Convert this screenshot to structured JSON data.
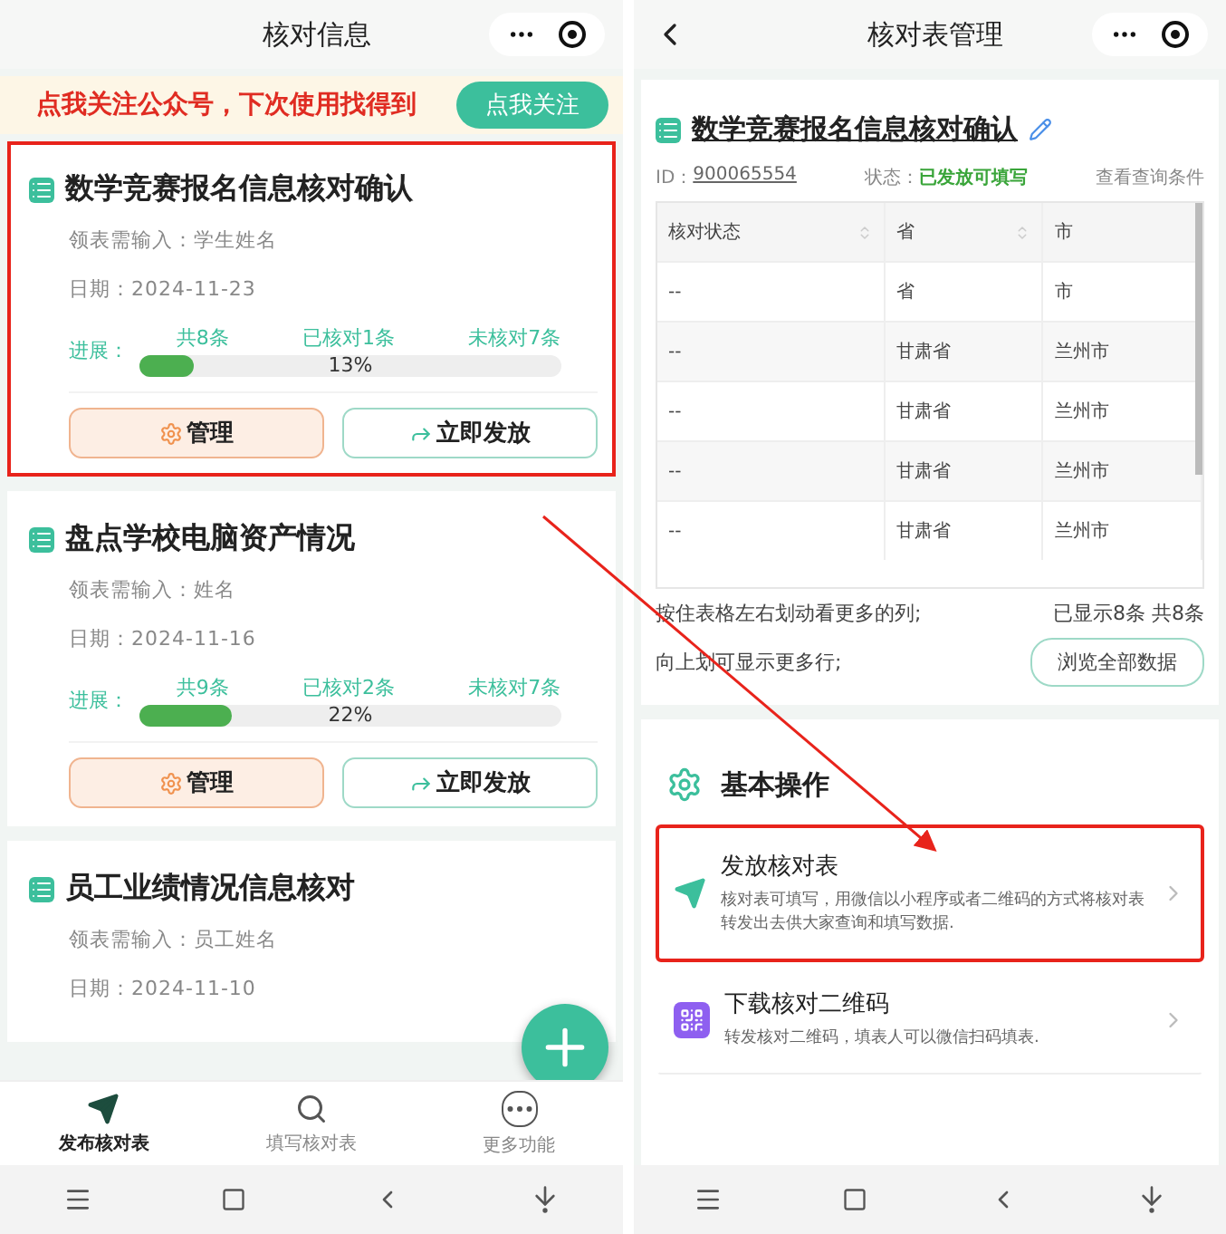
{
  "left_screen": {
    "title": "核对信息",
    "banner": {
      "text": "点我关注公众号，下次使用找得到",
      "button": "点我关注"
    },
    "cards": [
      {
        "title": "数学竞赛报名信息核对确认",
        "input_label": "领表需输入：学生姓名",
        "date": "日期：2024-11-23",
        "progress_label": "进展：",
        "total": "共8条",
        "checked": "已核对1条",
        "unchecked": "未核对7条",
        "level": 0.13,
        "percent": "13%",
        "manage_button": "管理",
        "publish_button": "立即发放",
        "highlighted": true
      },
      {
        "title": "盘点学校电脑资产情况",
        "input_label": "领表需输入：姓名",
        "date": "日期：2024-11-16",
        "progress_label": "进展：",
        "total": "共9条",
        "checked": "已核对2条",
        "unchecked": "未核对7条",
        "level": 0.22,
        "percent": "22%",
        "manage_button": "管理",
        "publish_button": "立即发放",
        "highlighted": false
      },
      {
        "title": "员工业绩情况信息核对",
        "input_label": "领表需输入：员工姓名",
        "date": "日期：2024-11-10",
        "highlighted": false
      }
    ],
    "tabs": [
      {
        "label": "发布核对表",
        "kind": "send",
        "selected": true
      },
      {
        "label": "填写核对表",
        "kind": "search",
        "selected": false
      },
      {
        "label": "更多功能",
        "kind": "more",
        "selected": false
      }
    ]
  },
  "right_screen": {
    "title": "核对表管理",
    "card": {
      "title": "数学竞赛报名信息核对确认",
      "id_label": "ID：",
      "id": "900065554",
      "status_label": "状态：",
      "status": "已发放可填写",
      "query_link": "查看查询条件",
      "table": {
        "columns": [
          {
            "label": "核对状态",
            "sortable": true
          },
          {
            "label": "省",
            "sortable": true
          },
          {
            "label": "市",
            "sortable": false
          }
        ],
        "rows": [
          [
            "--",
            "省",
            "市"
          ],
          [
            "--",
            "甘肃省",
            "兰州市"
          ],
          [
            "--",
            "甘肃省",
            "兰州市"
          ],
          [
            "--",
            "甘肃省",
            "兰州市"
          ],
          [
            "--",
            "甘肃省",
            "兰州市"
          ]
        ]
      },
      "hint_1": "按住表格左右划动看更多的列;",
      "hint_2": "向上划可显示更多行;",
      "count": "已显示8条 共8条",
      "browse_button": "浏览全部数据"
    },
    "section": {
      "title": "基本操作",
      "items": [
        {
          "kind": "send",
          "title": "发放核对表",
          "description": "核对表可填写，用微信以小程序或者二维码的方式将核对表转发出去供大家查询和填写数据.",
          "highlighted": true
        },
        {
          "kind": "qr",
          "title": "下载核对二维码",
          "description": "转发核对二维码，填表人可以微信扫码填表.",
          "highlighted": false
        }
      ]
    }
  }
}
